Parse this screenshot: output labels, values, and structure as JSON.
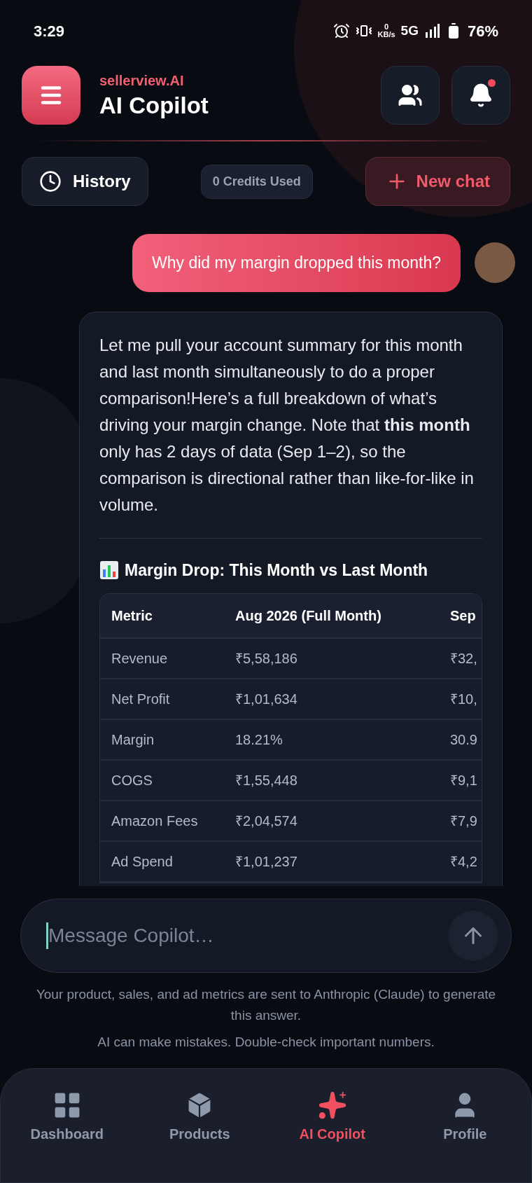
{
  "status_bar": {
    "time": "3:29",
    "net_speed": "0",
    "net_unit": "KB/s",
    "network": "5G",
    "battery": "76%"
  },
  "header": {
    "brand": "sellerview.AI",
    "title": "AI Copilot",
    "notification_unread": true
  },
  "toolbar": {
    "history": "History",
    "credits": "0 Credits Used",
    "new_chat": "New chat"
  },
  "messages": [
    {
      "kind": "user",
      "text": "Why did my margin dropped this month?"
    },
    {
      "kind": "assistant",
      "text": "Let me pull your account summary for this month and last month simultaneously to do a proper comparison!Here’s a full breakdown of what’s driving your margin change. Note that **this month** only has 2 days of data (Sep 1–2), so the comparison is directional rather than like-for-like in volume.",
      "heading": "Margin Drop: This Month vs Last Month",
      "table": {
        "columns": [
          "Metric",
          "Aug 2026 (Full Month)",
          "Sep"
        ],
        "rows": [
          [
            "Revenue",
            "₹5,58,186",
            "₹32,"
          ],
          [
            "Net Profit",
            "₹1,01,634",
            "₹10,"
          ],
          [
            "Margin",
            "18.21%",
            "30.9"
          ],
          [
            "COGS",
            "₹1,55,448",
            "₹9,1"
          ],
          [
            "Amazon Fees",
            "₹2,04,574",
            "₹7,9"
          ],
          [
            "Ad Spend",
            "₹1,01,237",
            "₹4,2"
          ]
        ]
      }
    }
  ],
  "composer": {
    "placeholder": "Message Copilot…"
  },
  "disclaimer": [
    "Your product, sales, and ad metrics are sent to Anthropic (Claude) to generate this answer.",
    "AI can make mistakes. Double-check important numbers."
  ],
  "nav": [
    {
      "kind": "dashboard",
      "label": "Dashboard",
      "selected": false
    },
    {
      "kind": "products",
      "label": "Products",
      "selected": false
    },
    {
      "kind": "copilot",
      "label": "AI Copilot",
      "selected": true
    },
    {
      "kind": "profile",
      "label": "Profile",
      "selected": false
    }
  ]
}
